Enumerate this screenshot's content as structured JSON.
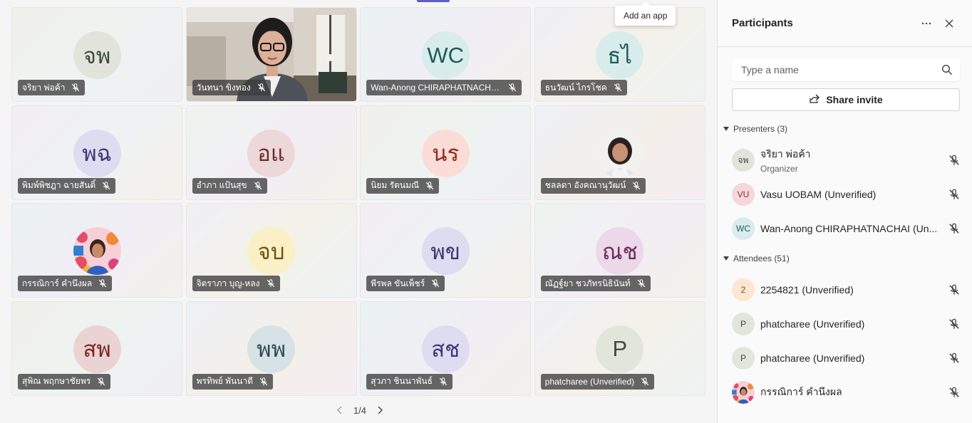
{
  "tooltip": "Add an app",
  "pager": {
    "label": "1/4"
  },
  "tiles": [
    {
      "initials": "จพ",
      "name": "จริยา พ่อค้า",
      "avatar_bg": "#e2e4dc",
      "avatar_fg": "#3f4a3a"
    },
    {
      "initials": "",
      "name": "วันทนา ขิงทอง",
      "video": true
    },
    {
      "initials": "WC",
      "name": "Wan-Anong CHIRAPHATNACHA...",
      "avatar_bg": "#d8eceb",
      "avatar_fg": "#1f5a5a"
    },
    {
      "initials": "ธไ",
      "name": "ธนวัฒน์ ไกรโชค",
      "avatar_bg": "#d8eceb",
      "avatar_fg": "#1f5a5a"
    },
    {
      "initials": "พฉ",
      "name": "พิมพ์พิชฎา ฉายสันติ์",
      "avatar_bg": "#dedcf0",
      "avatar_fg": "#3d3873"
    },
    {
      "initials": "อแ",
      "name": "อำภา แป้นสุข",
      "avatar_bg": "#ecd8d8",
      "avatar_fg": "#6a2c2c"
    },
    {
      "initials": "นร",
      "name": "นิยม รัตนมณี",
      "avatar_bg": "#fcdcd6",
      "avatar_fg": "#8a2c1e"
    },
    {
      "initials": "",
      "name": "ชลลดา อังคณานุวัฒน์",
      "photo": "woman"
    },
    {
      "initials": "",
      "name": "กรรณิการ์ คำนึงผล",
      "photo": "flowers"
    },
    {
      "initials": "จบ",
      "name": "จิตราภา บุญ-หลง",
      "avatar_bg": "#fbefc5",
      "avatar_fg": "#6b5410"
    },
    {
      "initials": "พข",
      "name": "พีรพล ขันเพ็ชร์",
      "avatar_bg": "#dedcf0",
      "avatar_fg": "#3d3873"
    },
    {
      "initials": "ณช",
      "name": "ณัฏฐ์ยา ชวภัทรนิธินันท์",
      "avatar_bg": "#ecd8e8",
      "avatar_fg": "#6a2c5a"
    },
    {
      "initials": "สพ",
      "name": "สุพิณ พฤกษาชัยพร",
      "avatar_bg": "#ecd3d3",
      "avatar_fg": "#7a2626"
    },
    {
      "initials": "พพ",
      "name": "พรทิพย์ พันนาดี",
      "avatar_bg": "#d6e2e6",
      "avatar_fg": "#2e4a55"
    },
    {
      "initials": "สช",
      "name": "สุวภา ชินนาพันธ์",
      "avatar_bg": "#dedcf0",
      "avatar_fg": "#3d3873"
    },
    {
      "initials": "P",
      "name": "phatcharee (Unverified)",
      "avatar_bg": "#e1e6dc",
      "avatar_fg": "#3f4a3a"
    }
  ],
  "panel": {
    "title": "Participants",
    "search_placeholder": "Type a name",
    "share_label": "Share invite",
    "presenters_label": "Presenters (3)",
    "attendees_label": "Attendees (51)",
    "presenters": [
      {
        "initials": "จพ",
        "name": "จริยา พ่อค้า",
        "role": "Organizer",
        "avatar_bg": "#e2e4dc",
        "avatar_fg": "#3f4a3a"
      },
      {
        "initials": "VU",
        "name": "Vasu UOBAM (Unverified)",
        "avatar_bg": "#f5d7d9",
        "avatar_fg": "#8a2c33"
      },
      {
        "initials": "WC",
        "name": "Wan-Anong CHIRAPHATNACHAI (Un...",
        "avatar_bg": "#d8eceb",
        "avatar_fg": "#1f5a5a"
      }
    ],
    "attendees": [
      {
        "initials": "2",
        "name": "2254821 (Unverified)",
        "avatar_bg": "#fde6d2",
        "avatar_fg": "#8a4a15"
      },
      {
        "initials": "P",
        "name": "phatcharee (Unverified)",
        "avatar_bg": "#e1e6dc",
        "avatar_fg": "#3f4a3a"
      },
      {
        "initials": "P",
        "name": "phatcharee (Unverified)",
        "avatar_bg": "#e1e6dc",
        "avatar_fg": "#3f4a3a"
      },
      {
        "initials": "",
        "name": "กรรณิการ์ คำนึงผล",
        "photo": "flowers"
      }
    ]
  }
}
